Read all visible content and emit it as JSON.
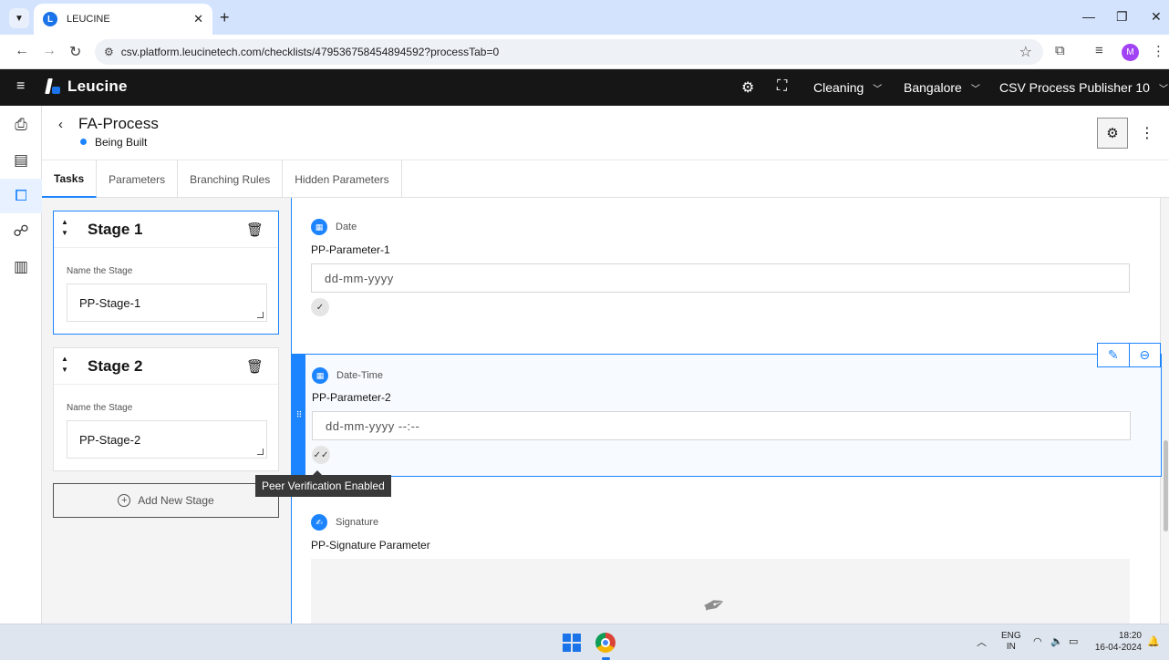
{
  "browser": {
    "tab_title": "LEUCINE",
    "tab_favicon": "L",
    "url": "csv.platform.leucinetech.com/checklists/479536758454894592?processTab=0",
    "profile_initial": "M"
  },
  "appbar": {
    "brand": "Leucine",
    "facility": "Cleaning",
    "location": "Bangalore",
    "role": "CSV Process Publisher 10"
  },
  "process": {
    "title": "FA-Process",
    "status": "Being Built"
  },
  "tabs": [
    {
      "label": "Tasks",
      "active": true
    },
    {
      "label": "Parameters",
      "active": false
    },
    {
      "label": "Branching Rules",
      "active": false
    },
    {
      "label": "Hidden Parameters",
      "active": false
    }
  ],
  "stages": [
    {
      "title": "Stage 1",
      "name_label": "Name the Stage",
      "name_value": "PP-Stage-1"
    },
    {
      "title": "Stage 2",
      "name_label": "Name the Stage",
      "name_value": "PP-Stage-2"
    }
  ],
  "add_stage_label": "Add New Stage",
  "parameters": [
    {
      "type": "Date",
      "name": "PP-Parameter-1",
      "placeholder": "dd-mm-yyyy"
    },
    {
      "type": "Date-Time",
      "name": "PP-Parameter-2",
      "placeholder": "dd-mm-yyyy --:--"
    },
    {
      "type": "Signature",
      "name": "PP-Signature Parameter"
    }
  ],
  "tooltip": "Peer Verification Enabled",
  "taskbar": {
    "lang_line1": "ENG",
    "lang_line2": "IN",
    "time": "18:20",
    "date": "16-04-2024"
  },
  "colors": {
    "accent": "#1d84ff",
    "header_bg": "#161616",
    "browser_chrome": "#d3e3fd"
  }
}
